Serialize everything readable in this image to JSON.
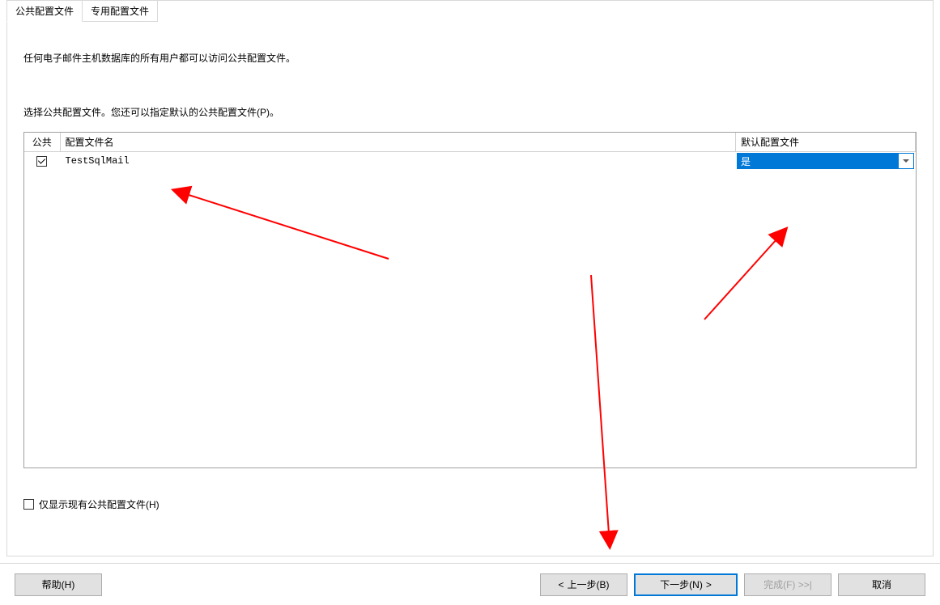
{
  "tabs": {
    "public": "公共配置文件",
    "private": "专用配置文件"
  },
  "panel": {
    "description": "任何电子邮件主机数据库的所有用户都可以访问公共配置文件。",
    "instruction": "选择公共配置文件。您还可以指定默认的公共配置文件(P)。"
  },
  "table": {
    "headers": {
      "public": "公共",
      "profile_name": "配置文件名",
      "default_profile": "默认配置文件"
    },
    "rows": [
      {
        "public_checked": true,
        "profile_name": "TestSqlMail",
        "default_value": "是"
      }
    ]
  },
  "show_only_existing_label": "仅显示现有公共配置文件(H)",
  "footer": {
    "help": "帮助(H)",
    "back": "上一步(B)",
    "next": "下一步(N)",
    "finish": "完成(F) >>|",
    "cancel": "取消"
  }
}
